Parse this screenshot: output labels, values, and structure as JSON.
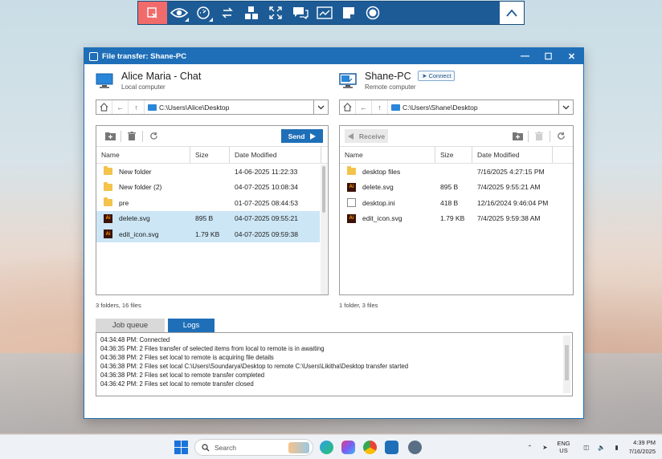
{
  "remote_toolbar": {
    "buttons": [
      {
        "icon": "disconnect-icon"
      },
      {
        "icon": "eye-icon"
      },
      {
        "icon": "settings-dial-icon"
      },
      {
        "icon": "transfer-arrows-icon"
      },
      {
        "icon": "keyboard-keys-icon"
      },
      {
        "icon": "fullscreen-icon"
      },
      {
        "icon": "chat-icon"
      },
      {
        "icon": "whiteboard-icon"
      },
      {
        "icon": "note-icon"
      },
      {
        "icon": "record-icon"
      },
      {
        "icon": "collapse-up-icon"
      }
    ],
    "colors": {
      "bar": "#1d5b96",
      "danger": "#f26b6b"
    }
  },
  "dialog": {
    "title": "File transfer: Shane-PC",
    "local": {
      "name": "Alice Maria - Chat",
      "subtitle": "Local computer",
      "path": "C:\\Users\\Alice\\Desktop",
      "send_label": "Send",
      "columns": [
        "Name",
        "Size",
        "Date Modified"
      ],
      "rows": [
        {
          "name": "New folder",
          "type": "folder",
          "size": "",
          "date": "14-06-2025 11:22:33",
          "selected": false
        },
        {
          "name": "New folder (2)",
          "type": "folder",
          "size": "",
          "date": "04-07-2025 10:08:34",
          "selected": false
        },
        {
          "name": "pre",
          "type": "folder",
          "size": "",
          "date": "01-07-2025 08:44:53",
          "selected": false
        },
        {
          "name": "delete.svg",
          "type": "ai",
          "size": "895 B",
          "date": "04-07-2025 09:55:21",
          "selected": true
        },
        {
          "name": "edit_icon.svg",
          "type": "ai",
          "size": "1.79 KB",
          "date": "04-07-2025 09:59:38",
          "selected": true
        }
      ],
      "count": "3 folders, 16 files"
    },
    "remote": {
      "name": "Shane-PC",
      "connect_label": "Connect",
      "subtitle": "Remote computer",
      "path": "C:\\Users\\Shane\\Desktop",
      "receive_label": "Receive",
      "columns": [
        "Name",
        "Size",
        "Date Modified"
      ],
      "rows": [
        {
          "name": "desktop files",
          "type": "folder",
          "size": "",
          "date": "7/16/2025 4:27:15 PM"
        },
        {
          "name": "delete.svg",
          "type": "ai",
          "size": "895 B",
          "date": "7/4/2025 9:55:21 AM"
        },
        {
          "name": "desktop.ini",
          "type": "ini",
          "size": "418 B",
          "date": "12/16/2024 9:46:04 PM"
        },
        {
          "name": "edit_icon.svg",
          "type": "ai",
          "size": "1.79 KB",
          "date": "7/4/2025 9:59:38 AM"
        }
      ],
      "count": "1 folder, 3 files"
    },
    "tabs": {
      "job_queue": "Job queue",
      "logs": "Logs",
      "active": "logs"
    },
    "logs": [
      "04:34:48 PM: Connected",
      "04:36:35 PM: 2 Files transfer of selected items from local to remote is in awaiting",
      "04:36:38 PM: 2 Files set local to remote is acquiring file details",
      "04:36:38 PM: 2 Files set local C:\\Users\\Soundarya\\Desktop to remote C:\\Users\\Likitha\\Desktop transfer started",
      "04:36:38 PM: 2 Files set local to remote transfer completed",
      "04:36:42 PM: 2 Files set local to remote transfer closed"
    ]
  },
  "taskbar": {
    "search_placeholder": "Search",
    "lang_top": "ENG",
    "lang_bottom": "US",
    "time": "4:39 PM",
    "date": "7/16/2025"
  }
}
